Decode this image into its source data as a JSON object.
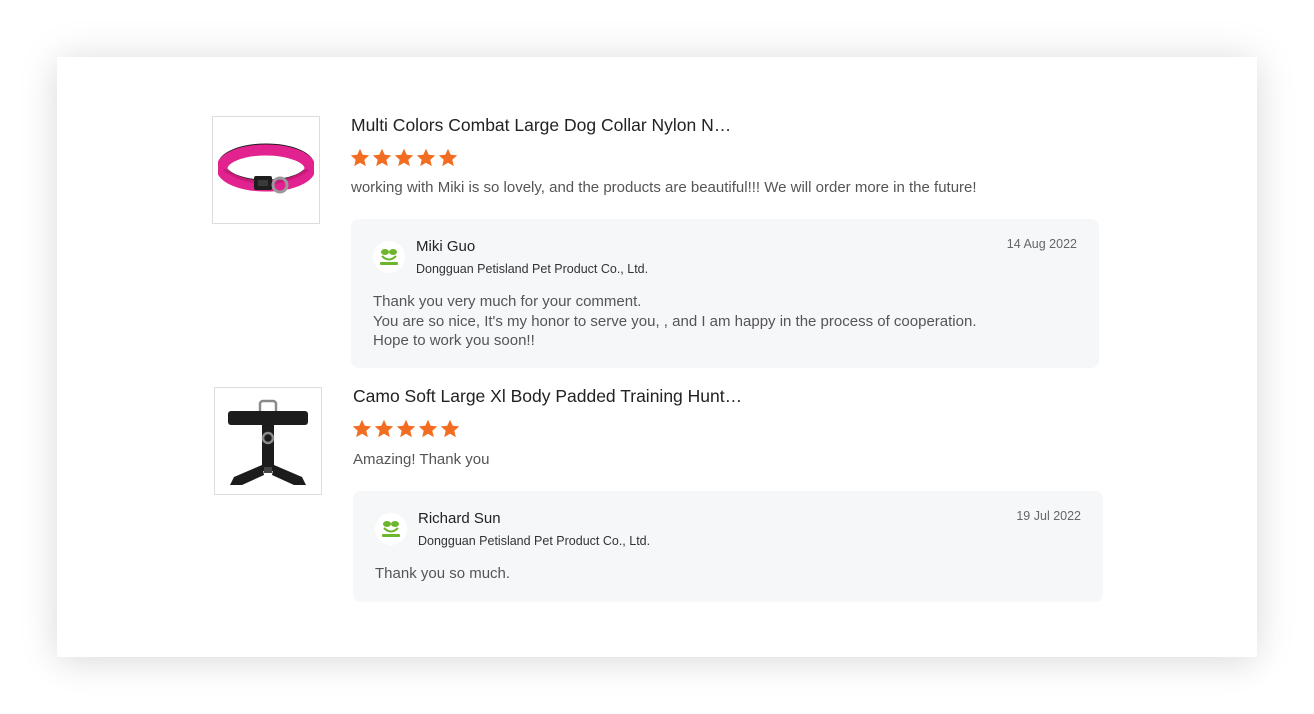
{
  "reviews": [
    {
      "product_title": "Multi Colors Combat Large Dog Collar Nylon N…",
      "product_image": "pink-dog-collar",
      "rating": 5,
      "comment": "working with Miki is so lovely, and the products are beautiful!!! We will order more in the future!",
      "reply": {
        "name": "Miki Guo",
        "company": "Dongguan Petisland Pet Product Co., Ltd.",
        "date": "14 Aug 2022",
        "logo_text": "Petisland",
        "lines": [
          "Thank you very much for your comment.",
          "You are so nice, It's my honor to serve you, , and I am happy in the process of cooperation.",
          "Hope to work you soon!!"
        ]
      }
    },
    {
      "product_title": "Camo Soft Large Xl Body Padded Training Hunt…",
      "product_image": "black-dog-harness",
      "rating": 5,
      "comment": "Amazing! Thank you",
      "reply": {
        "name": "Richard Sun",
        "company": "Dongguan Petisland Pet Product Co., Ltd.",
        "date": "19 Jul 2022",
        "logo_text": "Petisland",
        "lines": [
          "Thank you so much."
        ]
      }
    }
  ],
  "colors": {
    "star": "#f26c21",
    "reply_bg": "#f6f7f9",
    "logo_green": "#6cb52d"
  }
}
